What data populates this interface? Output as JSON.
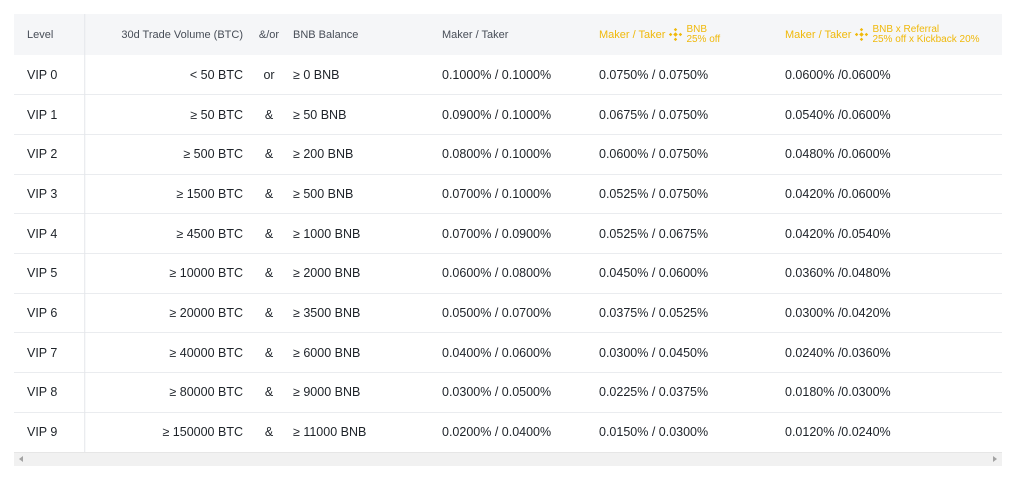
{
  "table": {
    "headers": {
      "level": "Level",
      "volume": "30d Trade Volume (BTC)",
      "andor": "&/or",
      "bnb_balance": "BNB Balance",
      "maker_taker": "Maker / Taker",
      "bnb_discount": {
        "label": "Maker / Taker",
        "line1": "BNB",
        "line2": "25% off"
      },
      "bnb_referral": {
        "label": "Maker / Taker",
        "line1": "BNB x Referral",
        "line2": "25% off x Kickback 20%"
      }
    },
    "rows": [
      {
        "level": "VIP 0",
        "volume": "< 50 BTC",
        "andor": "or",
        "bnb": "≥ 0 BNB",
        "maker_taker": "0.1000% / 0.1000%",
        "bnb_discount": "0.0750% / 0.0750%",
        "bnb_referral": "0.0600% /0.0600%"
      },
      {
        "level": "VIP 1",
        "volume": "≥ 50 BTC",
        "andor": "&",
        "bnb": "≥ 50 BNB",
        "maker_taker": "0.0900% / 0.1000%",
        "bnb_discount": "0.0675% / 0.0750%",
        "bnb_referral": "0.0540% /0.0600%"
      },
      {
        "level": "VIP 2",
        "volume": "≥ 500 BTC",
        "andor": "&",
        "bnb": "≥ 200 BNB",
        "maker_taker": "0.0800% / 0.1000%",
        "bnb_discount": "0.0600% / 0.0750%",
        "bnb_referral": "0.0480% /0.0600%"
      },
      {
        "level": "VIP 3",
        "volume": "≥ 1500 BTC",
        "andor": "&",
        "bnb": "≥ 500 BNB",
        "maker_taker": "0.0700% / 0.1000%",
        "bnb_discount": "0.0525% / 0.0750%",
        "bnb_referral": "0.0420% /0.0600%"
      },
      {
        "level": "VIP 4",
        "volume": "≥ 4500 BTC",
        "andor": "&",
        "bnb": "≥ 1000 BNB",
        "maker_taker": "0.0700% / 0.0900%",
        "bnb_discount": "0.0525% / 0.0675%",
        "bnb_referral": "0.0420% /0.0540%"
      },
      {
        "level": "VIP 5",
        "volume": "≥ 10000 BTC",
        "andor": "&",
        "bnb": "≥ 2000 BNB",
        "maker_taker": "0.0600% / 0.0800%",
        "bnb_discount": "0.0450% / 0.0600%",
        "bnb_referral": "0.0360% /0.0480%"
      },
      {
        "level": "VIP 6",
        "volume": "≥ 20000 BTC",
        "andor": "&",
        "bnb": "≥ 3500 BNB",
        "maker_taker": "0.0500% / 0.0700%",
        "bnb_discount": "0.0375% / 0.0525%",
        "bnb_referral": "0.0300% /0.0420%"
      },
      {
        "level": "VIP 7",
        "volume": "≥ 40000 BTC",
        "andor": "&",
        "bnb": "≥ 6000 BNB",
        "maker_taker": "0.0400% / 0.0600%",
        "bnb_discount": "0.0300% / 0.0450%",
        "bnb_referral": "0.0240% /0.0360%"
      },
      {
        "level": "VIP 8",
        "volume": "≥ 80000 BTC",
        "andor": "&",
        "bnb": "≥ 9000 BNB",
        "maker_taker": "0.0300% / 0.0500%",
        "bnb_discount": "0.0225% / 0.0375%",
        "bnb_referral": "0.0180% /0.0300%"
      },
      {
        "level": "VIP 9",
        "volume": "≥ 150000 BTC",
        "andor": "&",
        "bnb": "≥ 11000 BNB",
        "maker_taker": "0.0200% / 0.0400%",
        "bnb_discount": "0.0150% / 0.0300%",
        "bnb_referral": "0.0120% /0.0240%"
      }
    ]
  },
  "icons": {
    "bnb": "bnb-logo-icon",
    "scroll_left": "scroll-left-arrow-icon",
    "scroll_right": "scroll-right-arrow-icon"
  },
  "colors": {
    "accent": "#f0b90b",
    "header_bg": "#f5f6f8",
    "divider": "#eaecef",
    "text": "#1e2329"
  }
}
